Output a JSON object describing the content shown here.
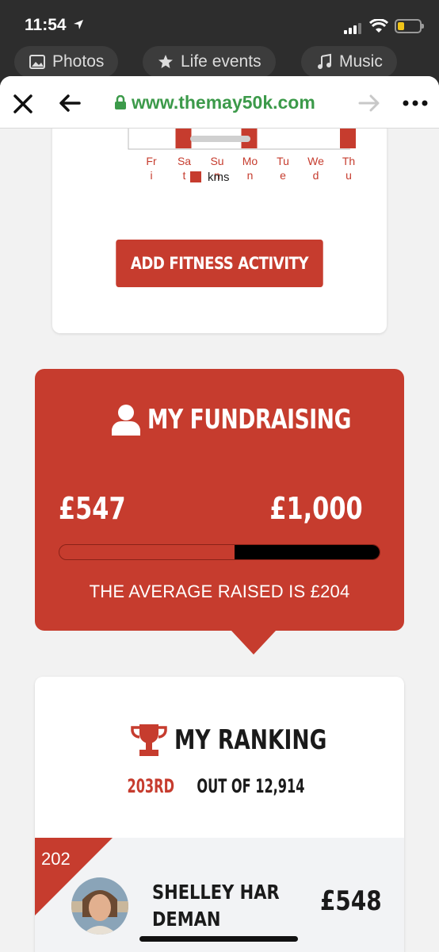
{
  "status_bar": {
    "time": "11:54"
  },
  "background_tabs": [
    {
      "label": "Photos",
      "icon": "photos-icon"
    },
    {
      "label": "Life events",
      "icon": "life-events-icon"
    },
    {
      "label": "Music",
      "icon": "music-icon"
    }
  ],
  "browser": {
    "url": "www.themay50k.com"
  },
  "colors": {
    "accent": "#c63c2e",
    "url_green": "#3c9a4a"
  },
  "fitness": {
    "button_label": "ADD FITNESS ACTIVITY"
  },
  "chart_data": {
    "type": "bar",
    "categories": [
      "Fri",
      "Sat",
      "Sun",
      "Mon",
      "Tue",
      "Wed",
      "Thu"
    ],
    "series": [
      {
        "name": "kms",
        "values": [
          0,
          1,
          0,
          1,
          0,
          0,
          1
        ]
      }
    ],
    "legend": "bottom",
    "note_visible_portion": "only the bottom of the bars is visible; values estimated"
  },
  "fundraising": {
    "title": "MY FUNDRAISING",
    "raised": "£547",
    "target": "£1,000",
    "progress_fraction": 0.547,
    "average_text": "THE AVERAGE RAISED IS £204"
  },
  "ranking": {
    "title": "MY RANKING",
    "position": "203RD",
    "out_of": "OUT OF 12,914",
    "rows": [
      {
        "rank": "202",
        "name": "SHELLEY HARDEMAN",
        "amount": "£548"
      }
    ]
  }
}
